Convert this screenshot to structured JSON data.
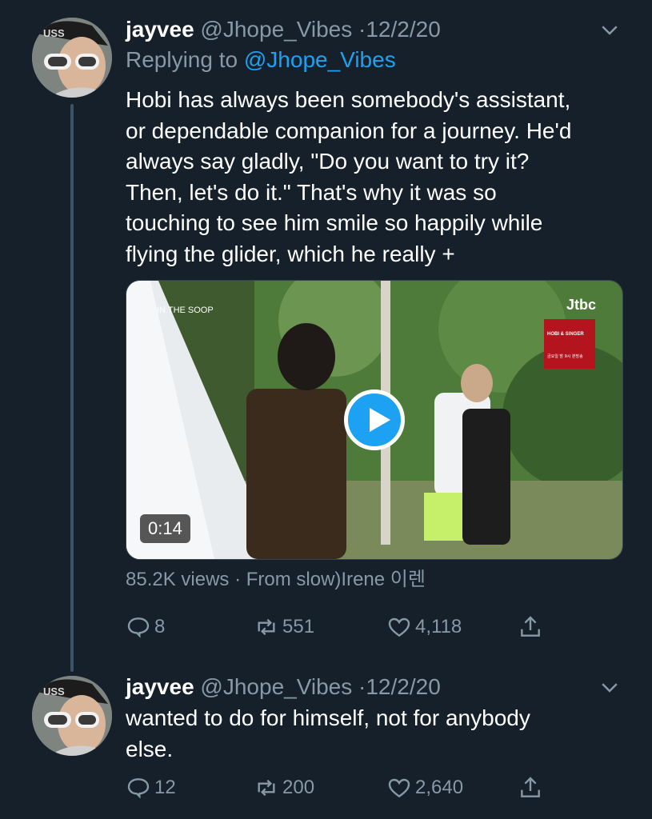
{
  "tweets": [
    {
      "display_name": "jayvee",
      "handle": "@Jhope_Vibes",
      "separator": "·",
      "date": "12/2/20",
      "replying_prefix": "Replying to",
      "replying_to": "@Jhope_Vibes",
      "text": "Hobi has always been somebody's assistant,\nor  dependable companion for a journey. He'd\nalways say gladly, \"Do you want to try it?\nThen, let's do it.\" That's why it was so\ntouching to see him smile so happily while\nflying the glider, which he really +",
      "video": {
        "duration": "0:14",
        "watermark_left": "IN THE SOOP",
        "watermark_right": "Jtbc",
        "promo_badge": "HOBI & SINGER",
        "promo_caption": "금요일 밤 9시 본방송"
      },
      "views": "85.2K views",
      "meta_separator": "·",
      "source": "From slow)Irene 이렌",
      "replies": "8",
      "retweets": "551",
      "likes": "4,118"
    },
    {
      "display_name": "jayvee",
      "handle": "@Jhope_Vibes",
      "separator": "·",
      "date": "12/2/20",
      "text": "wanted to do for himself, not for anybody\nelse.",
      "replies": "12",
      "retweets": "200",
      "likes": "2,640"
    }
  ],
  "icons": {
    "menu": "chevron-down-icon",
    "reply": "reply-bubble-icon",
    "retweet": "retweet-icon",
    "like": "heart-icon",
    "share": "share-icon",
    "play": "play-icon"
  },
  "colors": {
    "background": "#15202b",
    "text": "#ffffff",
    "muted": "#8899a6",
    "accent": "#1da1f2",
    "thread_line": "#3d5466"
  }
}
